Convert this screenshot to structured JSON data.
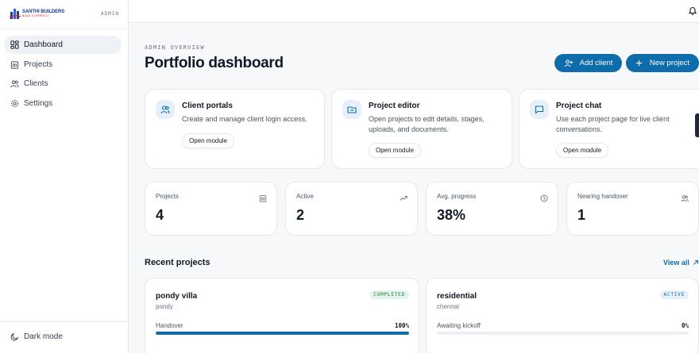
{
  "brand": {
    "name": "SANTHI BUILDERS",
    "tagline": "BUILD TO PERFECT",
    "role": "ADMIN"
  },
  "sidebar": {
    "items": [
      {
        "label": "Dashboard",
        "icon": "dashboard-icon",
        "active": true
      },
      {
        "label": "Projects",
        "icon": "building-icon",
        "active": false
      },
      {
        "label": "Clients",
        "icon": "users-icon",
        "active": false
      },
      {
        "label": "Settings",
        "icon": "gear-icon",
        "active": false
      }
    ],
    "dark_mode_label": "Dark mode"
  },
  "header": {
    "eyebrow": "ADMIN OVERVIEW",
    "title": "Portfolio dashboard",
    "add_client_label": "Add client",
    "new_project_label": "New project"
  },
  "modules": [
    {
      "title": "Client portals",
      "desc": "Create and manage client login access.",
      "button": "Open module",
      "icon": "users-icon"
    },
    {
      "title": "Project editor",
      "desc": "Open projects to edit details, stages, uploads, and documents.",
      "button": "Open module",
      "icon": "folder-icon"
    },
    {
      "title": "Project chat",
      "desc": "Use each project page for live client conversations.",
      "button": "Open module",
      "icon": "chat-icon"
    }
  ],
  "stats": [
    {
      "label": "Projects",
      "value": "4",
      "icon": "building-icon"
    },
    {
      "label": "Active",
      "value": "2",
      "icon": "trending-up-icon"
    },
    {
      "label": "Avg. progress",
      "value": "38%",
      "icon": "clock-icon"
    },
    {
      "label": "Nearing handover",
      "value": "1",
      "icon": "users-icon"
    }
  ],
  "recent": {
    "title": "Recent projects",
    "view_all": "View all",
    "projects": [
      {
        "name": "pondy villa",
        "location": "pondy",
        "status": "COMPLETED",
        "stage": "Handover",
        "progress_label": "100%",
        "progress": 100
      },
      {
        "name": "residential",
        "location": "chennai",
        "status": "ACTIVE",
        "stage": "Awaiting kickoff",
        "progress_label": "0%",
        "progress": 0
      }
    ]
  },
  "colors": {
    "accent": "#0f6cab",
    "completed": "#15803d",
    "background": "#f7f8fa"
  }
}
